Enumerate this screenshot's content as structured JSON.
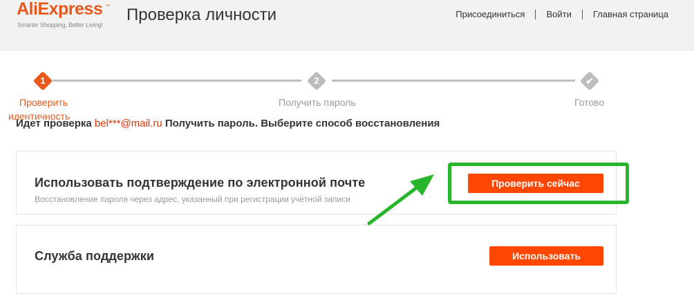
{
  "header": {
    "logo_text": "AliExpress",
    "logo_tm": "™",
    "logo_tagline": "Smarter Shopping, Better Living!",
    "title": "Проверка личности",
    "nav": {
      "join": "Присоединиться",
      "login": "Войти",
      "home": "Главная страница"
    }
  },
  "steps": [
    {
      "number": "1",
      "label_line1": "Проверить",
      "label_line2": "идентичность",
      "state": "active"
    },
    {
      "number": "2",
      "label": "Получить пароль",
      "state": "pending"
    },
    {
      "number": "✔",
      "label": "Готово",
      "state": "pending"
    }
  ],
  "verify": {
    "prefix": "Идет проверка",
    "email": "bel***@mail.ru",
    "suffix": "Получить пароль. Выберите способ восстановления"
  },
  "options": {
    "email": {
      "title": "Использовать подтверждение по электронной почте",
      "description": "Восстановление пароля через адрес, указанный при регистрации учётной записи",
      "button": "Проверить сейчас"
    },
    "support": {
      "title": "Служба поддержки",
      "button": "Использовать"
    }
  },
  "colors": {
    "brand": "#e8581c",
    "button": "#ff4702",
    "step_active": "#e8581c",
    "step_inactive": "#bdbdbd",
    "annotation": "#27b52b"
  },
  "icons": {
    "step_done": "checkmark-icon",
    "annotation": "green-arrow-icon"
  }
}
